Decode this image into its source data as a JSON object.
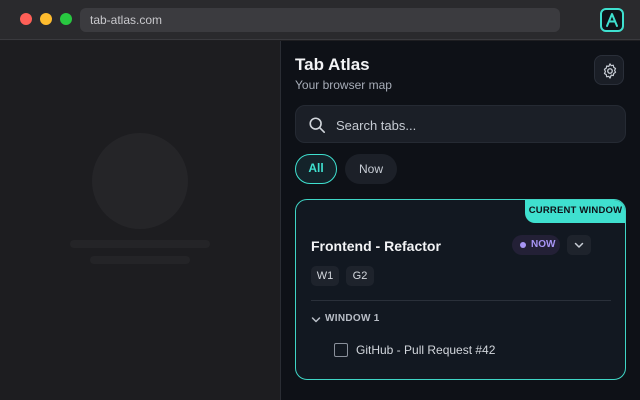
{
  "browser": {
    "url": "tab-atlas.com",
    "extension_icon": "atlas-logo-icon"
  },
  "panel": {
    "title": "Tab Atlas",
    "subtitle": "Your browser map",
    "settings_icon": "gear-icon",
    "search": {
      "placeholder": "Search tabs...",
      "value": ""
    },
    "filters": [
      {
        "label": "All",
        "active": true
      },
      {
        "label": "Now",
        "active": false
      }
    ],
    "group": {
      "badge": "CURRENT WINDOW",
      "title": "Frontend - Refactor",
      "status": "NOW",
      "chips": [
        "W1",
        "G2"
      ],
      "window_label": "WINDOW 1",
      "tabs": [
        {
          "title": "GitHub - Pull Request #42",
          "checked": false
        }
      ]
    }
  },
  "colors": {
    "accent": "#3fe0cf",
    "now_badge": "#a895f5",
    "panel_bg": "#0e1117"
  }
}
